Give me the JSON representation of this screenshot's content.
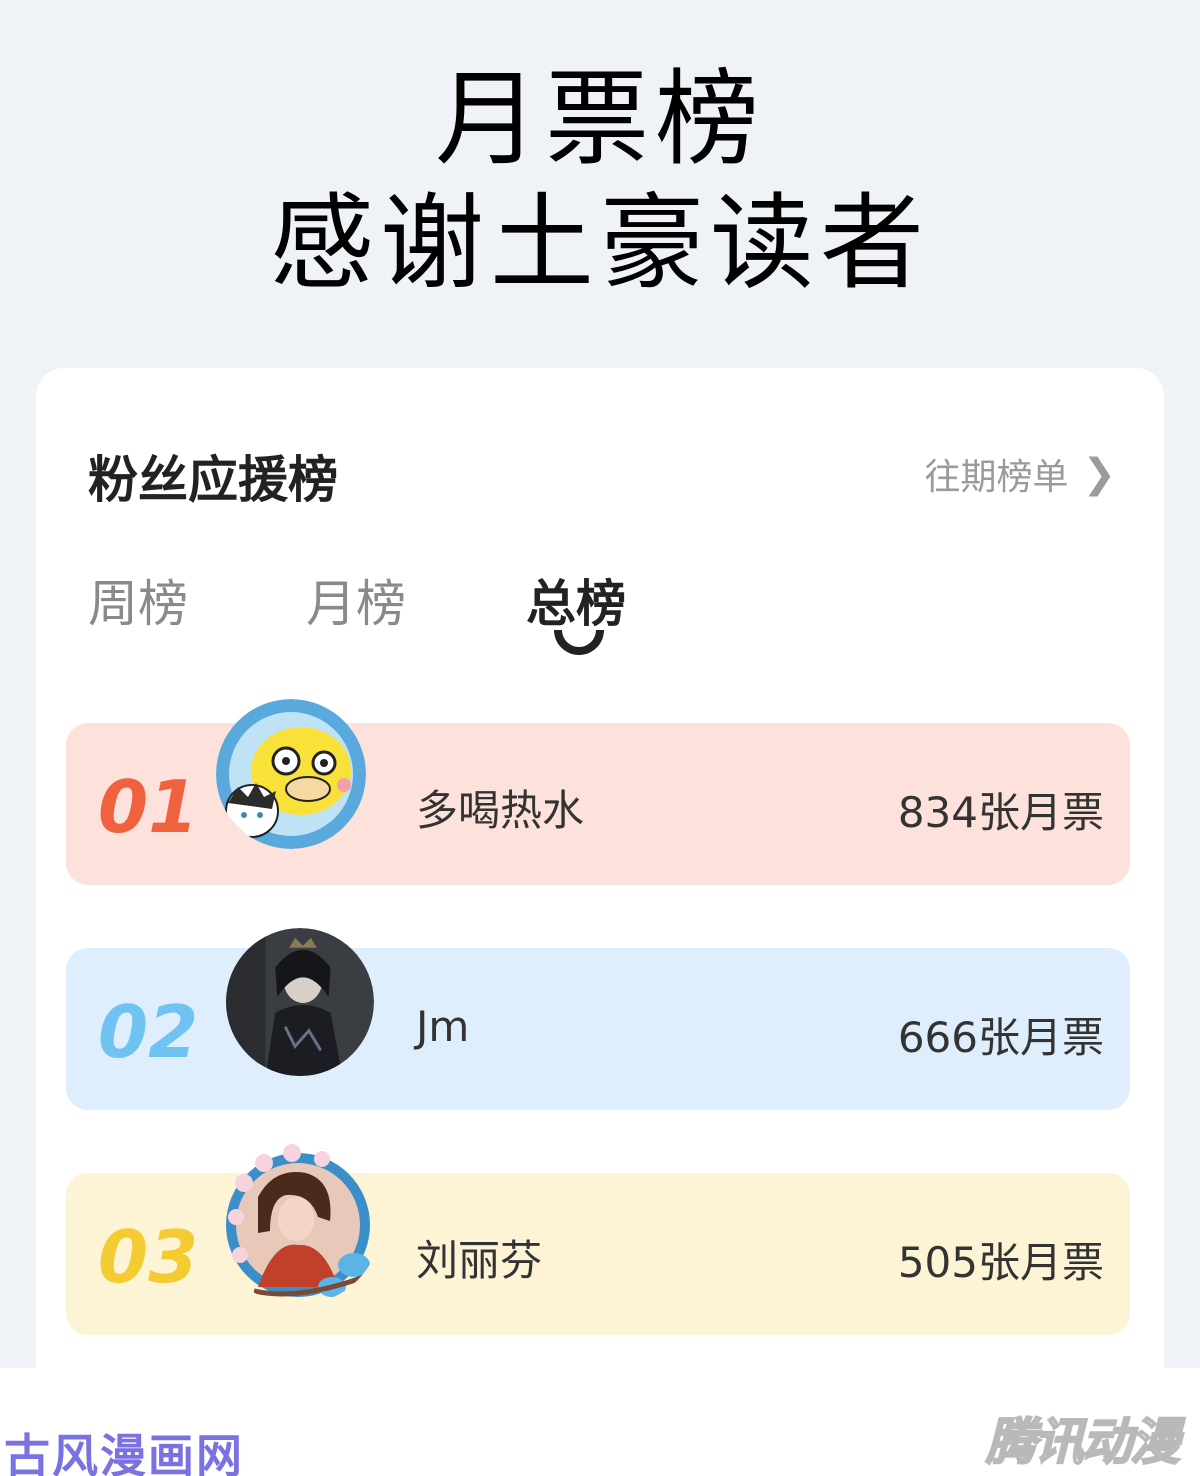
{
  "heading": {
    "line1": "月票榜",
    "line2": "感谢土豪读者"
  },
  "card": {
    "title": "粉丝应援榜",
    "history_label": "往期榜单",
    "tabs": [
      {
        "label": "周榜",
        "active": false
      },
      {
        "label": "月榜",
        "active": false
      },
      {
        "label": "总榜",
        "active": true
      }
    ]
  },
  "ranking": [
    {
      "rank": "01",
      "name": "多喝热水",
      "votes": "834张月票",
      "avatar": "psyduck-avatar-icon"
    },
    {
      "rank": "02",
      "name": "Jm",
      "votes": "666张月票",
      "avatar": "dark-portrait-avatar-icon"
    },
    {
      "rank": "03",
      "name": "刘丽芬",
      "votes": "505张月票",
      "avatar": "flower-frame-avatar-icon"
    }
  ],
  "colors": {
    "rank1_bg": "#fde2dc",
    "rank1_num": "#f0623e",
    "rank2_bg": "#dfeefd",
    "rank2_num": "#6ec3f0",
    "rank3_bg": "#fdf4d6",
    "rank3_num": "#f4cb30"
  },
  "watermarks": {
    "left": "古风漫画网",
    "right": "腾讯动漫"
  }
}
